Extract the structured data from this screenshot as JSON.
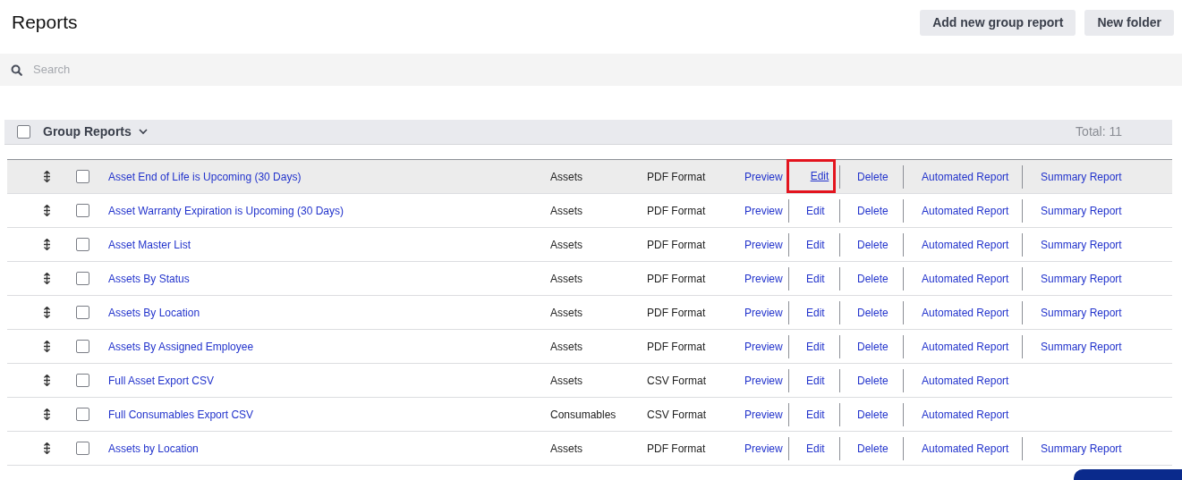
{
  "title": "Reports",
  "buttons": [
    "Add new group report",
    "New folder"
  ],
  "search": {
    "placeholder": "Search"
  },
  "group": {
    "label": "Group Reports",
    "checked": false,
    "total": "Total: 11"
  },
  "rows": [
    {
      "name": "Asset End of Life is Upcoming (30 Days)",
      "category": "Assets",
      "format": "PDF Format",
      "actions": [
        "Preview",
        "Edit",
        "Delete",
        "Automated Report",
        "Summary Report"
      ],
      "highlighted": true,
      "edit_marked": true,
      "checked": false
    },
    {
      "name": "Asset Warranty Expiration is Upcoming (30 Days)",
      "category": "Assets",
      "format": "PDF Format",
      "actions": [
        "Preview",
        "Edit",
        "Delete",
        "Automated Report",
        "Summary Report"
      ],
      "highlighted": false,
      "edit_marked": false,
      "checked": false
    },
    {
      "name": "Asset Master List",
      "category": "Assets",
      "format": "PDF Format",
      "actions": [
        "Preview",
        "Edit",
        "Delete",
        "Automated Report",
        "Summary Report"
      ],
      "highlighted": false,
      "edit_marked": false,
      "checked": false
    },
    {
      "name": "Assets By Status",
      "category": "Assets",
      "format": "PDF Format",
      "actions": [
        "Preview",
        "Edit",
        "Delete",
        "Automated Report",
        "Summary Report"
      ],
      "highlighted": false,
      "edit_marked": false,
      "checked": false
    },
    {
      "name": "Assets By Location",
      "category": "Assets",
      "format": "PDF Format",
      "actions": [
        "Preview",
        "Edit",
        "Delete",
        "Automated Report",
        "Summary Report"
      ],
      "highlighted": false,
      "edit_marked": false,
      "checked": false
    },
    {
      "name": "Assets By Assigned Employee",
      "category": "Assets",
      "format": "PDF Format",
      "actions": [
        "Preview",
        "Edit",
        "Delete",
        "Automated Report",
        "Summary Report"
      ],
      "highlighted": false,
      "edit_marked": false,
      "checked": false
    },
    {
      "name": "Full Asset Export CSV",
      "category": "Assets",
      "format": "CSV Format",
      "actions": [
        "Preview",
        "Edit",
        "Delete",
        "Automated Report"
      ],
      "highlighted": false,
      "edit_marked": false,
      "checked": false
    },
    {
      "name": "Full Consumables Export CSV",
      "category": "Consumables",
      "format": "CSV Format",
      "actions": [
        "Preview",
        "Edit",
        "Delete",
        "Automated Report"
      ],
      "highlighted": false,
      "edit_marked": false,
      "checked": false
    },
    {
      "name": "Assets by Location",
      "category": "Assets",
      "format": "PDF Format",
      "actions": [
        "Preview",
        "Edit",
        "Delete",
        "Automated Report",
        "Summary Report"
      ],
      "highlighted": false,
      "edit_marked": false,
      "checked": false
    }
  ]
}
